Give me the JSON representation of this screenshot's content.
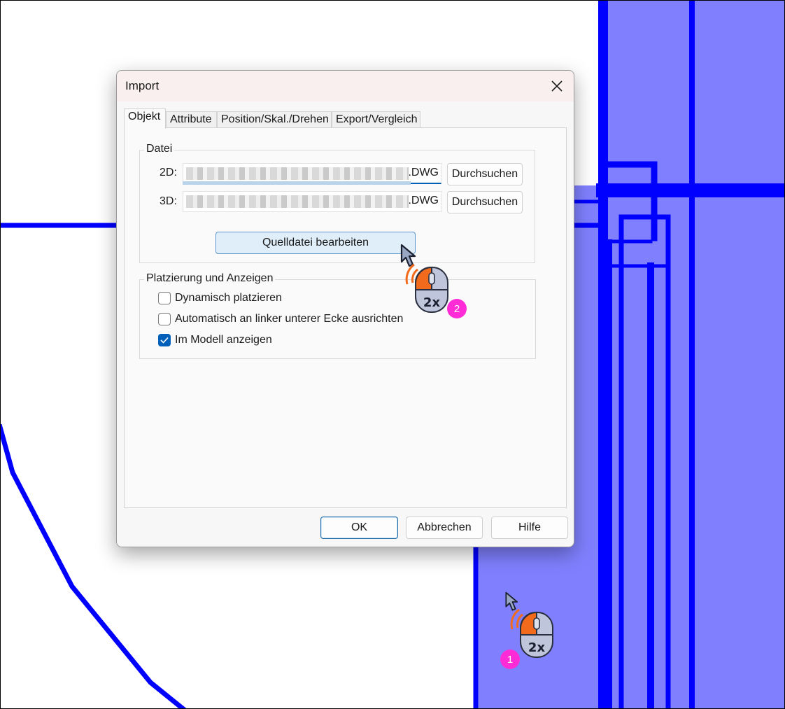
{
  "dialog": {
    "title": "Import",
    "close_icon": "close-icon",
    "tabs": [
      {
        "label": "Objekt",
        "active": true
      },
      {
        "label": "Attribute",
        "active": false
      },
      {
        "label": "Position/Skal./Drehen",
        "active": false
      },
      {
        "label": "Export/Vergleich",
        "active": false
      }
    ],
    "file_group": {
      "label": "Datei",
      "row_2d": {
        "label": "2D:",
        "value_ext": ".DWG",
        "browse_label": "Durchsuchen"
      },
      "row_3d": {
        "label": "3D:",
        "value_ext": ".DWG",
        "browse_label": "Durchsuchen"
      },
      "edit_source_label": "Quelldatei bearbeiten"
    },
    "placement_group": {
      "label": "Platzierung und Anzeigen",
      "options": [
        {
          "label": "Dynamisch platzieren",
          "checked": false
        },
        {
          "label": "Automatisch an linker unterer Ecke ausrichten",
          "checked": false
        },
        {
          "label": "Im Modell anzeigen",
          "checked": true
        }
      ]
    },
    "footer": {
      "ok_label": "OK",
      "cancel_label": "Abbrechen",
      "help_label": "Hilfe"
    }
  },
  "annotations": {
    "step1": {
      "badge": "1",
      "click_text": "2x",
      "icon": "mouse-double-click-icon"
    },
    "step2": {
      "badge": "2",
      "click_text": "2x",
      "icon": "mouse-double-click-icon"
    }
  },
  "colors": {
    "cad_fill": "#8080ff",
    "cad_line": "#0000ff",
    "accent": "#005fb8",
    "badge": "#ff2bd6",
    "mouse_orange": "#f26a1b"
  }
}
